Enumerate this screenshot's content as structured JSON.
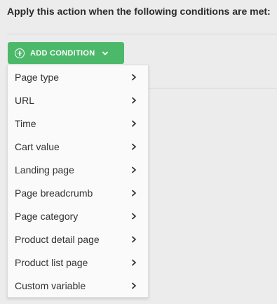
{
  "heading": "Apply this action when the following conditions are met:",
  "add_button": {
    "label": "ADD CONDITION",
    "color": "#4cb86a",
    "icon": "plus-circle-icon",
    "dropdown_icon": "chevron-down-icon"
  },
  "menu": {
    "items": [
      {
        "label": "Page type",
        "icon": "chevron-right-icon"
      },
      {
        "label": "URL",
        "icon": "chevron-right-icon"
      },
      {
        "label": "Time",
        "icon": "chevron-right-icon"
      },
      {
        "label": "Cart value",
        "icon": "chevron-right-icon"
      },
      {
        "label": "Landing page",
        "icon": "chevron-right-icon"
      },
      {
        "label": "Page breadcrumb",
        "icon": "chevron-right-icon"
      },
      {
        "label": "Page category",
        "icon": "chevron-right-icon"
      },
      {
        "label": "Product detail page",
        "icon": "chevron-right-icon"
      },
      {
        "label": "Product list page",
        "icon": "chevron-right-icon"
      },
      {
        "label": "Custom variable",
        "icon": "chevron-right-icon"
      }
    ]
  }
}
